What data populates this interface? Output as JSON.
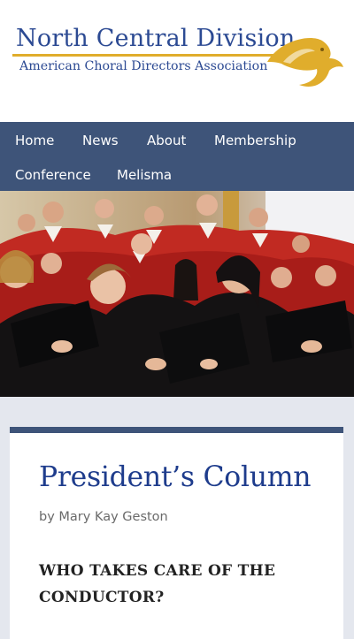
{
  "header": {
    "title": "North Central Division",
    "subtitle": "American Choral Directors Association",
    "logo_icon": "bird-logo-icon",
    "accent_color": "#e0ad2c",
    "brand_color": "#2c4a93"
  },
  "nav": {
    "items": [
      {
        "label": "Home"
      },
      {
        "label": "News"
      },
      {
        "label": "About"
      },
      {
        "label": "Membership"
      },
      {
        "label": "Conference"
      },
      {
        "label": "Melisma"
      }
    ],
    "background": "#3e5479"
  },
  "post": {
    "title": "President’s Column",
    "by_prefix": "by",
    "author": "Mary Kay Geston",
    "subhead": "WHO TAKES CARE OF THE CONDUCTOR?"
  }
}
